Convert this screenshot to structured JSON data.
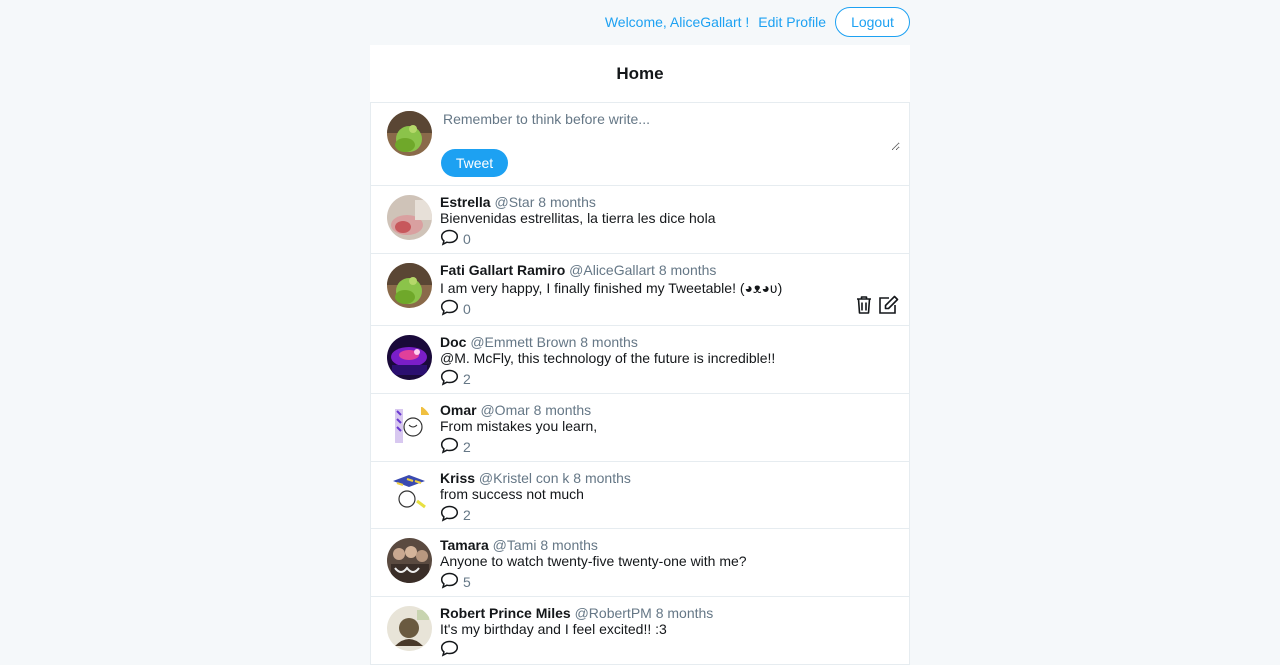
{
  "nav": {
    "welcome": "Welcome, AliceGallart !",
    "edit_profile": "Edit Profile",
    "logout": "Logout"
  },
  "home": {
    "title": "Home",
    "compose_placeholder": "Remember to think before write...",
    "tweet_button": "Tweet"
  },
  "tweets": [
    {
      "name": "Estrella",
      "handle": "@Star",
      "time": "8 months",
      "text": "Bienvenidas estrellitas, la tierra les dice hola",
      "replies": "0"
    },
    {
      "name": "Fati Gallart Ramiro",
      "handle": "@AliceGallart",
      "time": "8 months",
      "text": "I am very happy, I finally finished my Tweetable! (◕ᴥ◕ʋ)",
      "replies": "0",
      "own": true
    },
    {
      "name": "Doc",
      "handle": "@Emmett Brown",
      "time": "8 months",
      "text": "@M. McFly, this technology of the future is incredible!!",
      "replies": "2"
    },
    {
      "name": "Omar",
      "handle": "@Omar",
      "time": "8 months",
      "text": "From mistakes you learn,",
      "replies": "2"
    },
    {
      "name": "Kriss",
      "handle": "@Kristel con k",
      "time": "8 months",
      "text": "from success not much",
      "replies": "2"
    },
    {
      "name": "Tamara",
      "handle": "@Tami",
      "time": "8 months",
      "text": "Anyone to watch twenty-five twenty-one with me?",
      "replies": "5"
    },
    {
      "name": "Robert Prince Miles",
      "handle": "@RobertPM",
      "time": "8 months",
      "text": "It's my birthday and I feel excited!! :3",
      "replies": ""
    }
  ],
  "colors": {
    "accent": "#1da1f2",
    "muted": "#657786",
    "background": "#f5f8fa",
    "border": "#e6ecf0"
  }
}
